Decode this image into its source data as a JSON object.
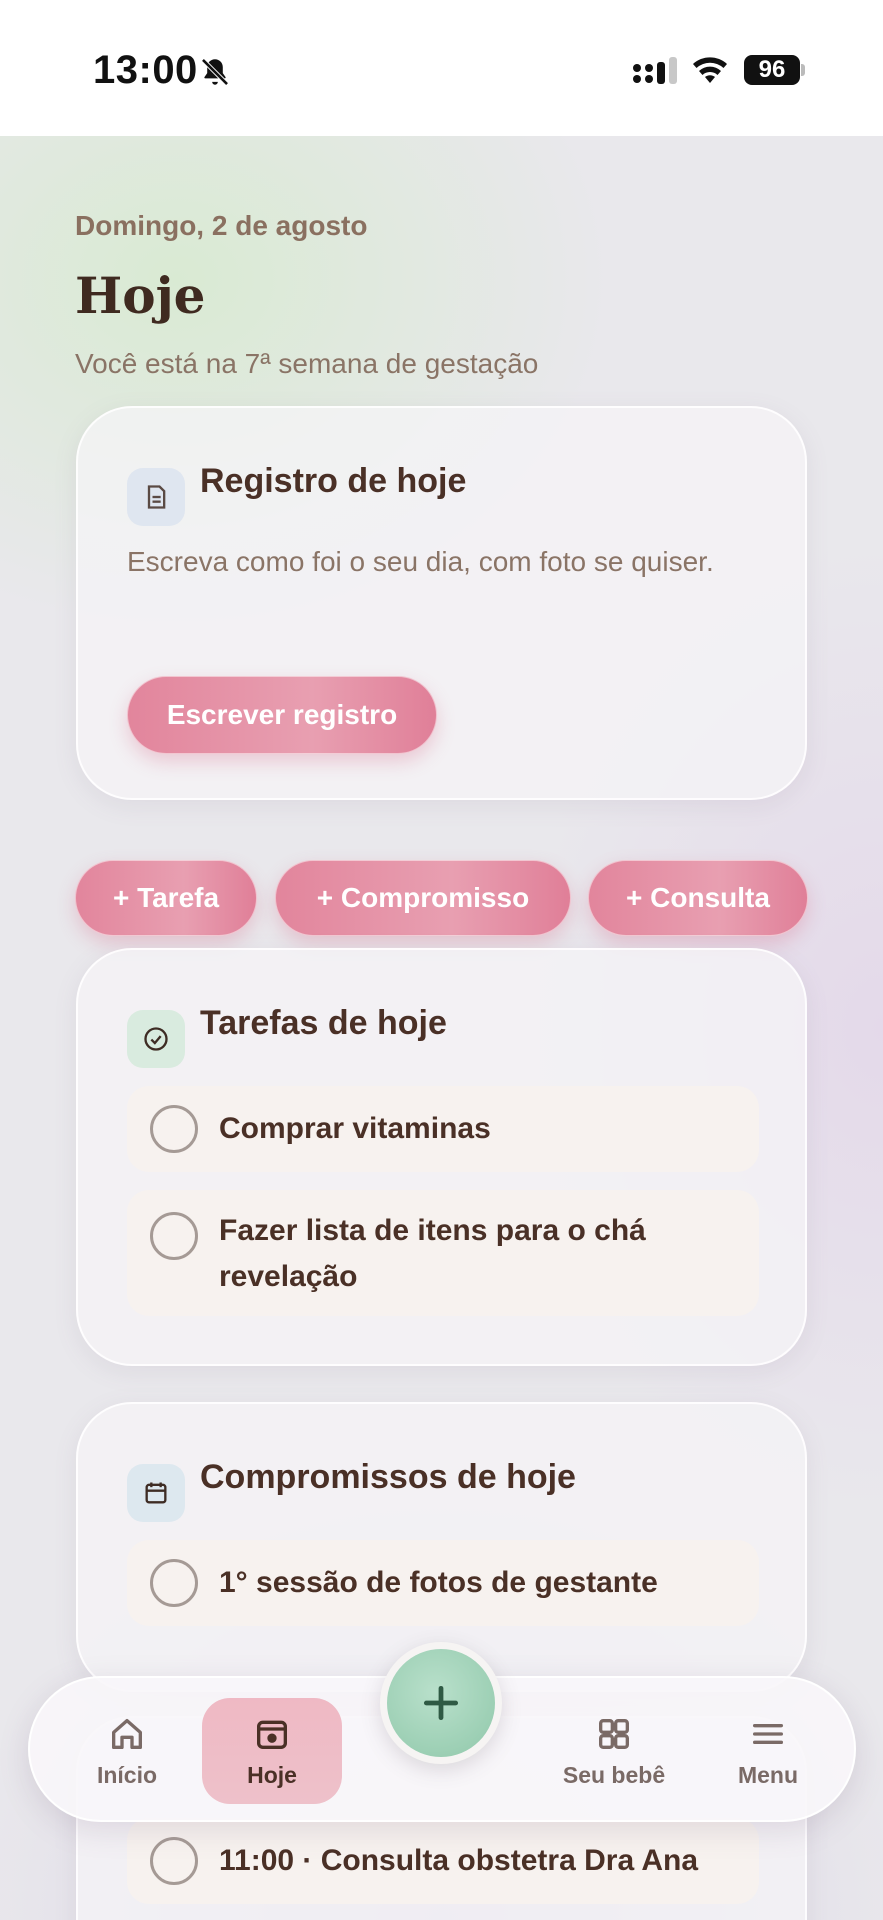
{
  "status_bar": {
    "time": "13:00",
    "battery": "96",
    "icons": [
      "bell-slash-icon",
      "signal-icon",
      "wifi-icon",
      "battery-icon"
    ]
  },
  "header": {
    "date": "Domingo, 2 de agosto",
    "title": "Hoje",
    "subtitle": "Você está na 7ª semana de gestação"
  },
  "journal_card": {
    "title": "Registro de hoje",
    "description": "Escreva como foi o seu dia, com foto se quiser.",
    "button": "Escrever registro",
    "icon": "document-icon"
  },
  "quick_actions": [
    "+ Tarefa",
    "+ Compromisso",
    "+ Consulta"
  ],
  "tasks_card": {
    "title": "Tarefas de hoje",
    "icon": "check-circle-icon",
    "items": [
      {
        "text": "Comprar vitaminas"
      },
      {
        "text": "Fazer lista de itens para o chá revelação"
      }
    ]
  },
  "appointments_card": {
    "title": "Compromissos de hoje",
    "icon": "calendar-icon",
    "items": [
      {
        "text": "1° sessão de fotos de gestante"
      }
    ]
  },
  "consult_item": {
    "text": "11:00 · Consulta obstetra Dra Ana"
  },
  "bottom_nav": {
    "items": [
      {
        "label": "Início",
        "icon": "home-icon",
        "active": false
      },
      {
        "label": "Hoje",
        "icon": "today-icon",
        "active": true
      },
      {
        "label": "Seu bebê",
        "icon": "grid-icon",
        "active": false
      },
      {
        "label": "Menu",
        "icon": "menu-icon",
        "active": false
      }
    ],
    "fab_icon": "plus-icon"
  },
  "colors": {
    "accent_pink": "#e2859c",
    "accent_green": "#9ccfb4",
    "text_dark": "#4a3026",
    "text_muted": "#8a7466"
  }
}
